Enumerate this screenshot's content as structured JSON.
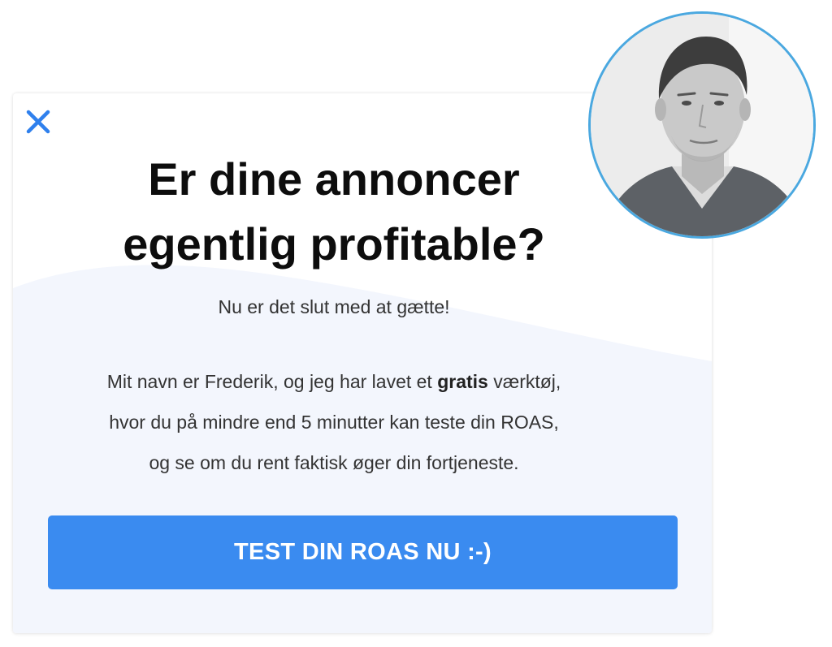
{
  "popup": {
    "headline_line1": "Er dine annoncer",
    "headline_line2": "egentlig profitable?",
    "subheadline": "Nu er det slut med at gætte!",
    "body": {
      "line1_before": "Mit navn er Frederik, og jeg har lavet et ",
      "line1_bold": "gratis",
      "line1_after": " værktøj,",
      "line2": "hvor du på mindre end 5 minutter kan teste din ROAS,",
      "line3": "og se om du rent faktisk øger din fortjeneste."
    },
    "cta_label": "TEST DIN ROAS NU :-)",
    "close_icon": "close-icon",
    "avatar": "avatar-photo"
  },
  "colors": {
    "accent": "#3a8bf0",
    "close_icon": "#2f80ed",
    "avatar_border": "#4aa8e0",
    "wave_background": "#f3f6fd",
    "headline": "#0d0d0d",
    "body_text": "#333333"
  }
}
